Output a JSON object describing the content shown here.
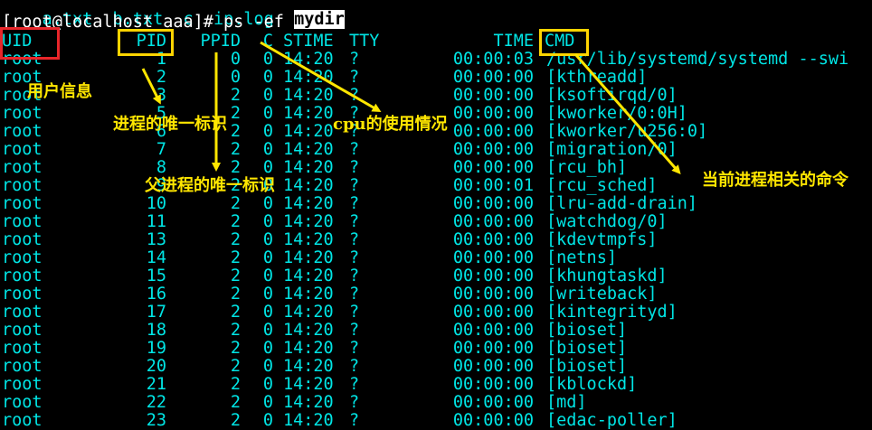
{
  "terminal": {
    "ls_files": [
      "a.txt",
      "b.txt",
      "c",
      "ip.log"
    ],
    "ls_dir": "mydir",
    "prompt": "[root@localhost aaa]# ps -ef",
    "headers": {
      "uid": "UID",
      "pid": "PID",
      "ppid": "PPID",
      "c": "C",
      "stime": "STIME",
      "tty": "TTY",
      "time": "TIME",
      "cmd": "CMD"
    },
    "rows": [
      {
        "uid": "root",
        "pid": "1",
        "ppid": "0",
        "c": "0",
        "stime": "14:20",
        "tty": "?",
        "time": "00:00:03",
        "cmd": "/usr/lib/systemd/systemd --swi"
      },
      {
        "uid": "root",
        "pid": "2",
        "ppid": "0",
        "c": "0",
        "stime": "14:20",
        "tty": "?",
        "time": "00:00:00",
        "cmd": "[kthreadd]"
      },
      {
        "uid": "root",
        "pid": "3",
        "ppid": "2",
        "c": "0",
        "stime": "14:20",
        "tty": "?",
        "time": "00:00:00",
        "cmd": "[ksoftirqd/0]"
      },
      {
        "uid": "root",
        "pid": "5",
        "ppid": "2",
        "c": "0",
        "stime": "14:20",
        "tty": "?",
        "time": "00:00:00",
        "cmd": "[kworker/0:0H]"
      },
      {
        "uid": "root",
        "pid": "6",
        "ppid": "2",
        "c": "0",
        "stime": "14:20",
        "tty": "?",
        "time": "00:00:00",
        "cmd": "[kworker/u256:0]"
      },
      {
        "uid": "root",
        "pid": "7",
        "ppid": "2",
        "c": "0",
        "stime": "14:20",
        "tty": "?",
        "time": "00:00:00",
        "cmd": "[migration/0]"
      },
      {
        "uid": "root",
        "pid": "8",
        "ppid": "2",
        "c": "0",
        "stime": "14:20",
        "tty": "?",
        "time": "00:00:00",
        "cmd": "[rcu_bh]"
      },
      {
        "uid": "root",
        "pid": "9",
        "ppid": "2",
        "c": "0",
        "stime": "14:20",
        "tty": "?",
        "time": "00:00:01",
        "cmd": "[rcu_sched]"
      },
      {
        "uid": "root",
        "pid": "10",
        "ppid": "2",
        "c": "0",
        "stime": "14:20",
        "tty": "?",
        "time": "00:00:00",
        "cmd": "[lru-add-drain]"
      },
      {
        "uid": "root",
        "pid": "11",
        "ppid": "2",
        "c": "0",
        "stime": "14:20",
        "tty": "?",
        "time": "00:00:00",
        "cmd": "[watchdog/0]"
      },
      {
        "uid": "root",
        "pid": "13",
        "ppid": "2",
        "c": "0",
        "stime": "14:20",
        "tty": "?",
        "time": "00:00:00",
        "cmd": "[kdevtmpfs]"
      },
      {
        "uid": "root",
        "pid": "14",
        "ppid": "2",
        "c": "0",
        "stime": "14:20",
        "tty": "?",
        "time": "00:00:00",
        "cmd": "[netns]"
      },
      {
        "uid": "root",
        "pid": "15",
        "ppid": "2",
        "c": "0",
        "stime": "14:20",
        "tty": "?",
        "time": "00:00:00",
        "cmd": "[khungtaskd]"
      },
      {
        "uid": "root",
        "pid": "16",
        "ppid": "2",
        "c": "0",
        "stime": "14:20",
        "tty": "?",
        "time": "00:00:00",
        "cmd": "[writeback]"
      },
      {
        "uid": "root",
        "pid": "17",
        "ppid": "2",
        "c": "0",
        "stime": "14:20",
        "tty": "?",
        "time": "00:00:00",
        "cmd": "[kintegrityd]"
      },
      {
        "uid": "root",
        "pid": "18",
        "ppid": "2",
        "c": "0",
        "stime": "14:20",
        "tty": "?",
        "time": "00:00:00",
        "cmd": "[bioset]"
      },
      {
        "uid": "root",
        "pid": "19",
        "ppid": "2",
        "c": "0",
        "stime": "14:20",
        "tty": "?",
        "time": "00:00:00",
        "cmd": "[bioset]"
      },
      {
        "uid": "root",
        "pid": "20",
        "ppid": "2",
        "c": "0",
        "stime": "14:20",
        "tty": "?",
        "time": "00:00:00",
        "cmd": "[bioset]"
      },
      {
        "uid": "root",
        "pid": "21",
        "ppid": "2",
        "c": "0",
        "stime": "14:20",
        "tty": "?",
        "time": "00:00:00",
        "cmd": "[kblockd]"
      },
      {
        "uid": "root",
        "pid": "22",
        "ppid": "2",
        "c": "0",
        "stime": "14:20",
        "tty": "?",
        "time": "00:00:00",
        "cmd": "[md]"
      },
      {
        "uid": "root",
        "pid": "23",
        "ppid": "2",
        "c": "0",
        "stime": "14:20",
        "tty": "?",
        "time": "00:00:00",
        "cmd": "[edac-poller]"
      }
    ]
  },
  "annotations": {
    "user_info": "用户信息",
    "pid_note": "进程的唯一标识",
    "ppid_note": "父进程的唯一标识",
    "cpu_note": "cpu的使用情况",
    "cmd_note": "当前进程相关的命令"
  },
  "colors": {
    "background": "#000000",
    "text": "#00e5e5",
    "prompt_text": "#ffffff",
    "annotation": "#ffe600",
    "box_yellow": "#ffd400",
    "box_red": "#e8262a"
  }
}
